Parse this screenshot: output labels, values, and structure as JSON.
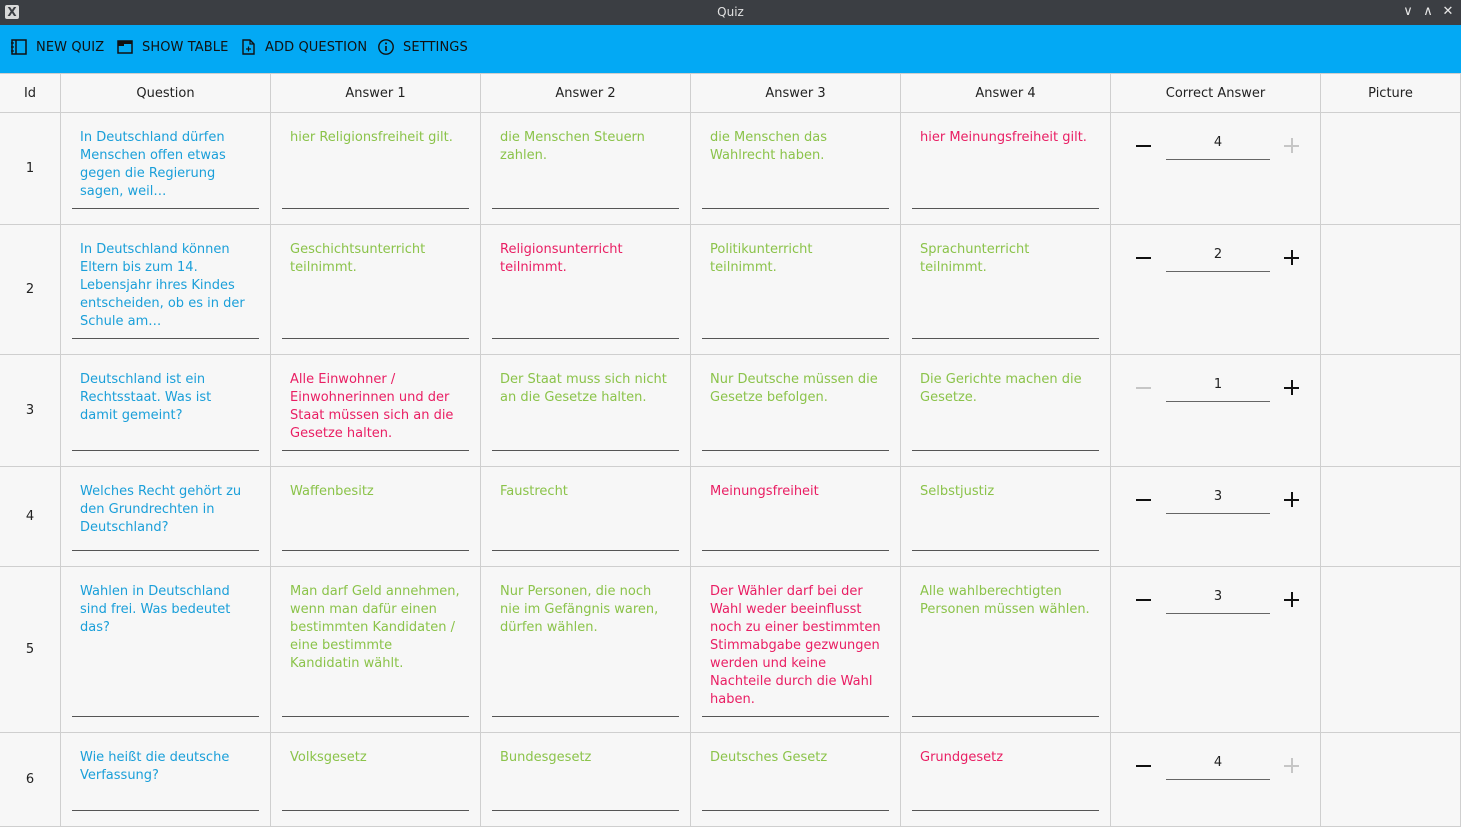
{
  "window": {
    "title": "Quiz",
    "app_icon": "X"
  },
  "toolbar": {
    "new_quiz": "NEW QUIZ",
    "show_table": "SHOW TABLE",
    "add_question": "ADD QUESTION",
    "settings": "SETTINGS"
  },
  "colors": {
    "toolbar": "#03a9f4",
    "question": "#1a9fd9",
    "wrong_answer": "#8bc34a",
    "correct_answer": "#e91e63"
  },
  "table": {
    "headers": [
      "Id",
      "Question",
      "Answer 1",
      "Answer 2",
      "Answer 3",
      "Answer 4",
      "Correct Answer",
      "Picture"
    ],
    "rows": [
      {
        "id": "1",
        "question": "In Deutschland dürfen Menschen offen etwas gegen die Regierung sagen, weil…",
        "answers": [
          "hier Religionsfreiheit gilt.",
          "die Menschen Steuern zahlen.",
          "die Menschen das Wahlrecht haben.",
          "hier Meinungsfreiheit gilt."
        ],
        "correct": "4"
      },
      {
        "id": "2",
        "question": "In Deutschland können Eltern bis zum 14. Lebensjahr ihres Kindes entscheiden, ob es in der Schule am…",
        "answers": [
          "Geschichtsunterricht teilnimmt.",
          "Religionsunterricht teilnimmt.",
          "Politikunterricht teilnimmt.",
          "Sprachunterricht teilnimmt."
        ],
        "correct": "2"
      },
      {
        "id": "3",
        "question": "Deutschland ist ein Rechtsstaat. Was ist damit gemeint?",
        "answers": [
          "Alle Einwohner / Einwohnerinnen und der Staat müssen sich an die Gesetze halten.",
          "Der Staat muss sich nicht an die Gesetze halten.",
          "Nur Deutsche müssen die Gesetze befolgen.",
          "Die Gerichte machen die Gesetze."
        ],
        "correct": "1"
      },
      {
        "id": "4",
        "question": "Welches Recht gehört zu den Grundrechten in Deutschland?",
        "answers": [
          "Waffenbesitz",
          "Faustrecht",
          "Meinungsfreiheit",
          "Selbstjustiz"
        ],
        "correct": "3"
      },
      {
        "id": "5",
        "question": "Wahlen in Deutschland sind frei. Was bedeutet das?",
        "answers": [
          "Man darf Geld annehmen, wenn man dafür einen bestimmten Kandidaten / eine bestimmte Kandidatin wählt.",
          "Nur Personen, die noch nie im Gefängnis waren, dürfen wählen.",
          "Der Wähler darf bei der Wahl weder beeinflusst noch zu einer bestimmten Stimmabgabe gezwungen werden und keine Nachteile durch die Wahl haben.",
          "Alle wahlberechtigten Personen müssen wählen."
        ],
        "correct": "3"
      },
      {
        "id": "6",
        "question": "Wie heißt die deutsche Verfassung?",
        "answers": [
          "Volksgesetz",
          "Bundesgesetz",
          "Deutsches Gesetz",
          "Grundgesetz"
        ],
        "correct": "4"
      }
    ]
  }
}
